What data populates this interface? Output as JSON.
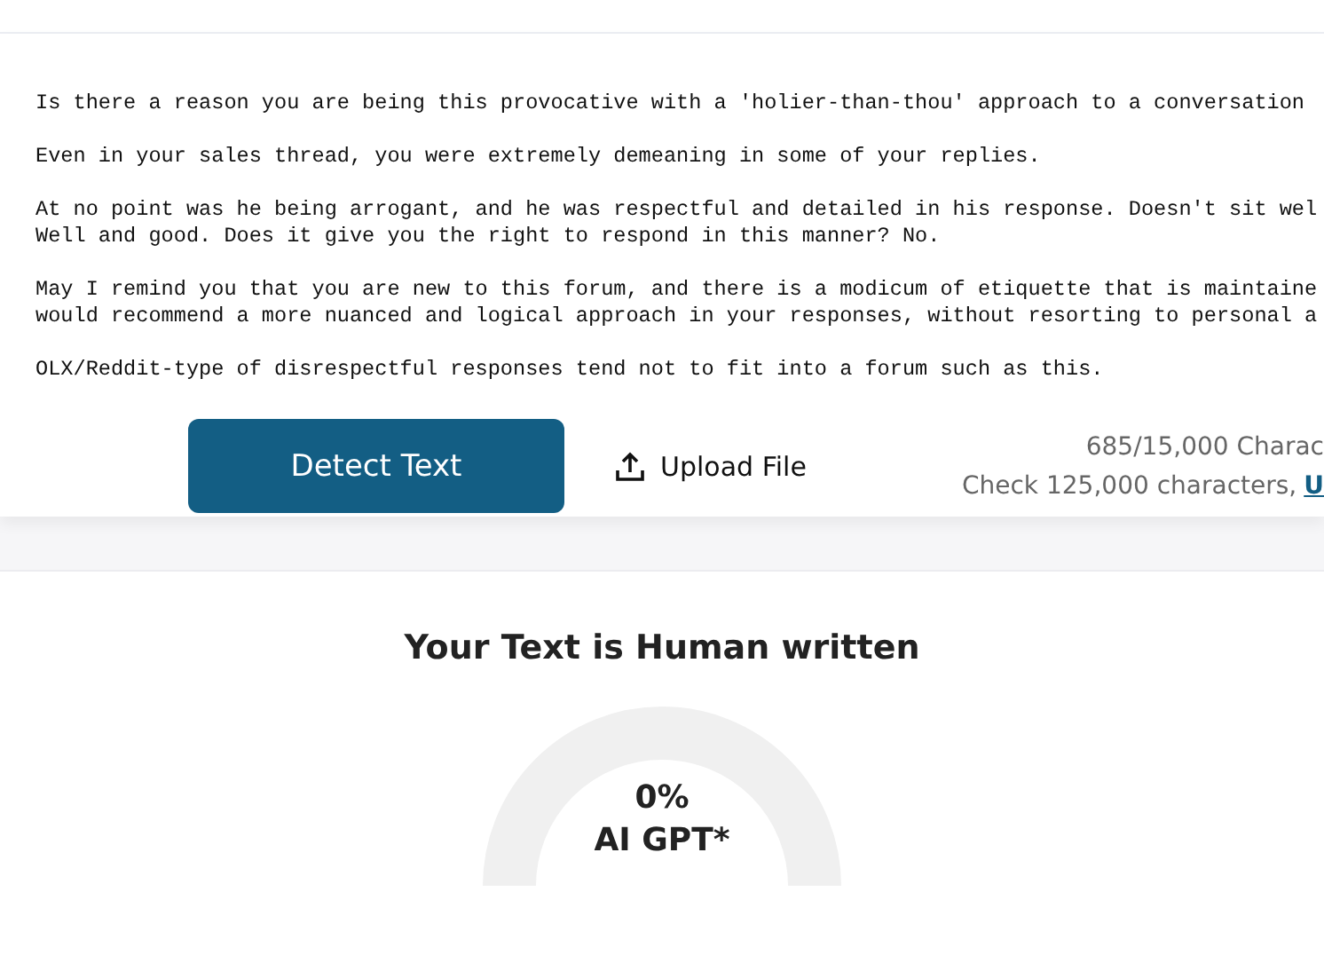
{
  "editor": {
    "paragraphs": [
      [
        "Is there a reason you are being this provocative with a 'holier-than-thou' approach to a conversation"
      ],
      [
        "Even in your sales thread, you were extremely demeaning in some of your replies."
      ],
      [
        "At no point was he being arrogant, and he was respectful and detailed in his response. Doesn't sit wel",
        "Well and good. Does it give you the right to respond in this manner? No."
      ],
      [
        "May I remind you that you are new to this forum, and there is a modicum of etiquette that is maintaine",
        "would recommend a more nuanced and logical approach in your responses, without resorting to personal a"
      ],
      [
        "OLX/Reddit-type of disrespectful responses tend not to fit into a forum such as this."
      ]
    ]
  },
  "actions": {
    "detect_button": "Detect Text",
    "upload_button": "Upload File",
    "char_count": "685/15,000 Charac",
    "upgrade_text": "Check 125,000 characters,",
    "upgrade_link": "U"
  },
  "result": {
    "title": "Your Text is Human written",
    "gauge": {
      "value": "0%",
      "label": "AI GPT*"
    }
  }
}
